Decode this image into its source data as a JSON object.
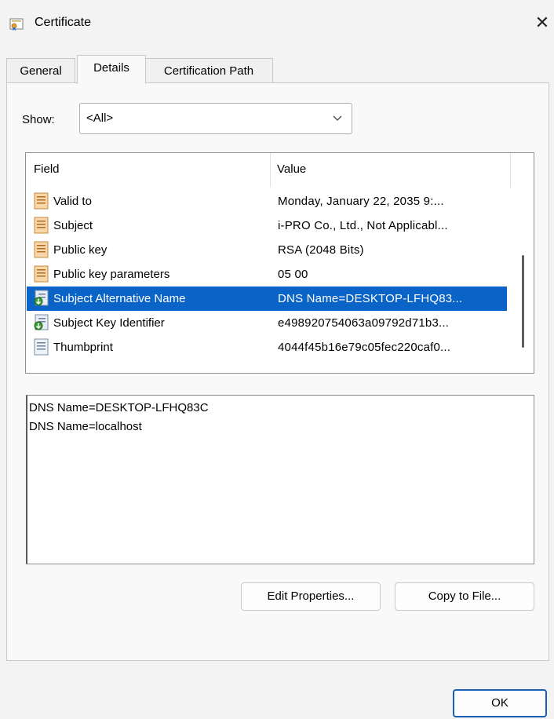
{
  "window": {
    "title": "Certificate",
    "close_glyph": "✕"
  },
  "tabs": [
    {
      "label": "General"
    },
    {
      "label": "Details"
    },
    {
      "label": "Certification Path"
    }
  ],
  "show": {
    "label": "Show:",
    "value": "<All>"
  },
  "list": {
    "columns": {
      "field": "Field",
      "value": "Value"
    },
    "rows": [
      {
        "field": "Valid to",
        "value": "Monday, January 22, 2035 9:...",
        "icon": "document-icon"
      },
      {
        "field": "Subject",
        "value": "i-PRO Co., Ltd., Not Applicabl...",
        "icon": "document-icon"
      },
      {
        "field": "Public key",
        "value": "RSA (2048 Bits)",
        "icon": "document-icon"
      },
      {
        "field": "Public key parameters",
        "value": "05 00",
        "icon": "document-icon"
      },
      {
        "field": "Subject Alternative Name",
        "value": "DNS Name=DESKTOP-LFHQ83...",
        "icon": "extension-icon",
        "selected": true
      },
      {
        "field": "Subject Key Identifier",
        "value": "e498920754063a09792d71b3...",
        "icon": "extension-icon"
      },
      {
        "field": "Thumbprint",
        "value": "4044f45b16e79c05fec220caf0...",
        "icon": "property-icon"
      }
    ]
  },
  "detail": {
    "lines": [
      "DNS Name=DESKTOP-LFHQ83C",
      "DNS Name=localhost"
    ]
  },
  "buttons": {
    "edit": "Edit Properties...",
    "copy": "Copy to File...",
    "ok": "OK"
  },
  "colors": {
    "selection": "#0a64c8",
    "focus_border": "#1b5fb5"
  }
}
